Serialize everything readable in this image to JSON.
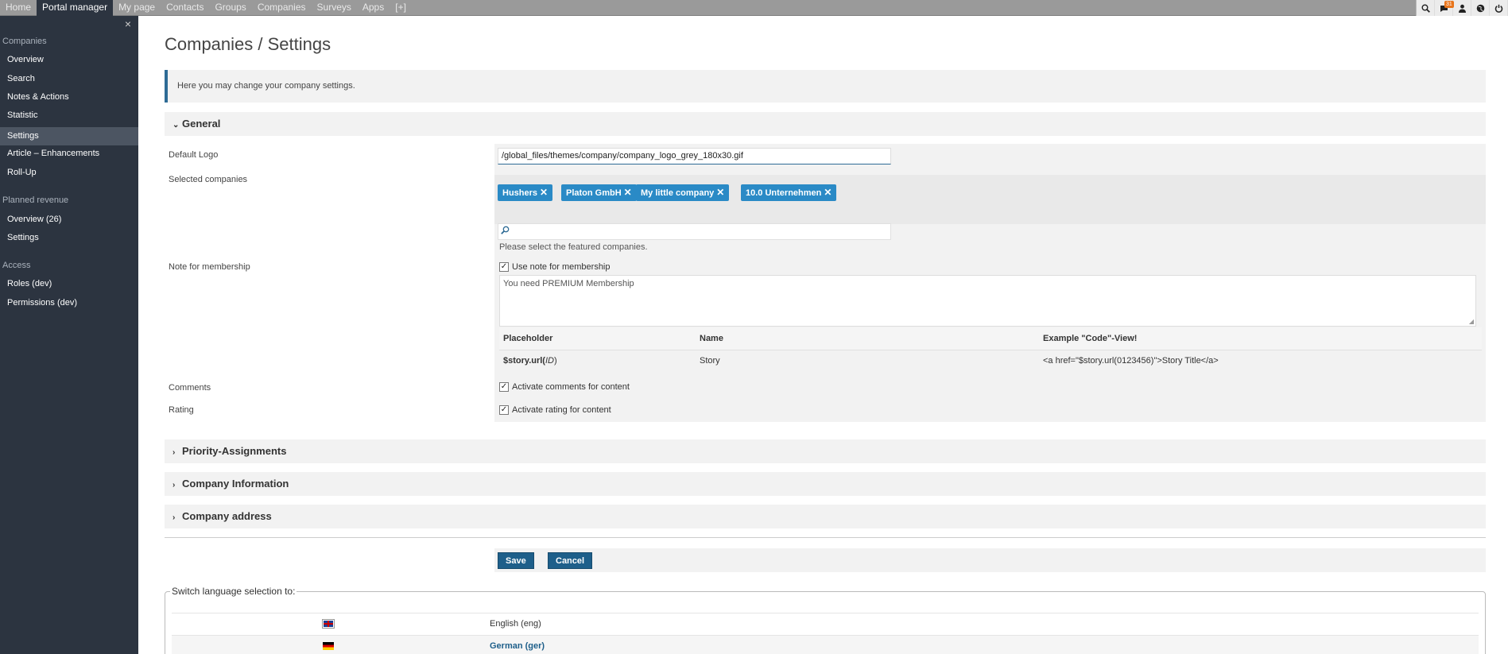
{
  "topbar": {
    "nav": [
      "Home",
      "Portal manager",
      "My page",
      "Contacts",
      "Groups",
      "Companies",
      "Surveys",
      "Apps",
      "[+]"
    ],
    "active_index": 1,
    "notification_count": "31",
    "icons": [
      "zoom-icon",
      "chat-icon",
      "user-icon",
      "globe-icon",
      "power-icon"
    ]
  },
  "sidebar": {
    "close": "×",
    "sections": [
      {
        "title": "Companies",
        "items": [
          "Overview",
          "Search",
          "Notes & Actions",
          "Statistic",
          "Settings",
          "Article – Enhancements",
          "Roll-Up"
        ]
      },
      {
        "title": "Planned revenue",
        "items": [
          "Overview (26)",
          "Settings"
        ]
      },
      {
        "title": "Access",
        "items": [
          "Roles (dev)",
          "Permissions (dev)"
        ]
      }
    ],
    "active_item": "Settings"
  },
  "page": {
    "title": "Companies / Settings",
    "info": "Here you may change your company settings."
  },
  "general": {
    "heading": "General",
    "default_logo_label": "Default Logo",
    "default_logo_value": "/global_files/themes/company/company_logo_grey_180x30.gif",
    "selected_companies_label": "Selected companies",
    "tags": [
      "Hushers",
      "Platon GmbH",
      "My little company",
      "10.0 Unternehmen"
    ],
    "tag_remove": "✕",
    "companies_hint": "Please select the featured companies.",
    "note_label": "Note for membership",
    "use_note_label": "Use note for membership",
    "use_note_checked": true,
    "note_text": "You need PREMIUM Membership",
    "placeholder_table": {
      "headers": [
        "Placeholder",
        "Name",
        "Example \"Code\"-View!"
      ],
      "row": {
        "placeholder_prefix": "$story.url(",
        "placeholder_arg": "ID",
        "placeholder_suffix": ")",
        "name": "Story",
        "example": "<a href=\"$story.url(0123456)\">Story Title</a>"
      }
    },
    "comments_label": "Comments",
    "comments_check": "Activate comments for content",
    "rating_label": "Rating",
    "rating_check": "Activate rating for content"
  },
  "collapsed_panels": [
    "Priority-Assignments",
    "Company Information",
    "Company address"
  ],
  "buttons": {
    "save": "Save",
    "cancel": "Cancel"
  },
  "language": {
    "legend": "Switch language selection to:",
    "rows": [
      {
        "name": "English (eng)",
        "flag": "uk-flag-icon",
        "link": false
      },
      {
        "name": "German (ger)",
        "flag": "german-flag-icon",
        "link": true
      }
    ]
  },
  "colors": {
    "sidebar": "#2c3440",
    "accent": "#2e6b95",
    "tag": "#2a8ac6",
    "button": "#1e5f8a",
    "badge": "#e8741a"
  }
}
